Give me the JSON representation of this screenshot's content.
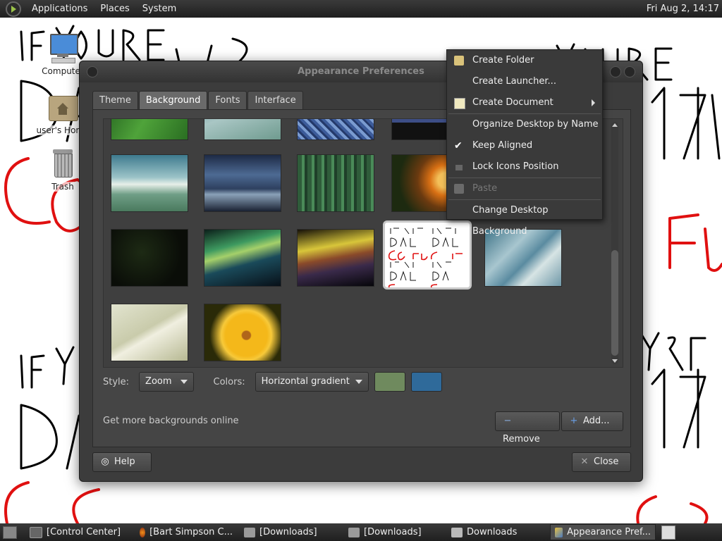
{
  "top_panel": {
    "menus": [
      "Applications",
      "Places",
      "System"
    ],
    "clock": "Fri Aug  2, 14:17"
  },
  "desktop_icons": [
    {
      "label": "Computer",
      "icon": "computer-icon"
    },
    {
      "label": "user's Home",
      "icon": "home-folder-icon"
    },
    {
      "label": "Trash",
      "icon": "trash-icon"
    }
  ],
  "wallpaper_text": [
    "IF YOU'RE",
    "DALJA1715",
    "GO FLOURPELE"
  ],
  "window": {
    "title": "Appearance Preferences",
    "tabs": [
      "Theme",
      "Background",
      "Fonts",
      "Interface"
    ],
    "active_tab": "Background",
    "style_label": "Style:",
    "style_value": "Zoom",
    "colors_label": "Colors:",
    "colors_value": "Horizontal gradient",
    "color_swatches": [
      "#6f8a5e",
      "#2f6a9a"
    ],
    "online_text": "Get more backgrounds online",
    "remove_label": "Remove",
    "add_label": "Add...",
    "help_label": "Help",
    "close_label": "Close"
  },
  "context_menu": {
    "items": [
      {
        "label": "Create Folder",
        "icon": "folder-new-icon",
        "enabled": true
      },
      {
        "label": "Create Launcher...",
        "icon": "",
        "enabled": true
      },
      {
        "label": "Create Document",
        "icon": "document-new-icon",
        "enabled": true,
        "submenu": true
      },
      {
        "label": "Organize Desktop by Name",
        "icon": "",
        "enabled": true
      },
      {
        "label": "Keep Aligned",
        "icon": "check-icon",
        "enabled": true
      },
      {
        "label": "Lock Icons Position",
        "icon": "lock-icon",
        "enabled": true
      },
      {
        "label": "Paste",
        "icon": "paste-icon",
        "enabled": false
      },
      {
        "label": "Change Desktop Background",
        "icon": "",
        "enabled": true
      }
    ]
  },
  "taskbar": {
    "items": [
      {
        "label": "[Control Center]",
        "icon": "control-center-icon"
      },
      {
        "label": "[Bart Simpson C...",
        "icon": "firefox-icon"
      },
      {
        "label": "[Downloads]",
        "icon": "folder-icon"
      },
      {
        "label": "[Downloads]",
        "icon": "folder-icon"
      },
      {
        "label": "Downloads",
        "icon": "folder-icon"
      },
      {
        "label": "Appearance Pref...",
        "icon": "appearance-icon"
      }
    ]
  }
}
